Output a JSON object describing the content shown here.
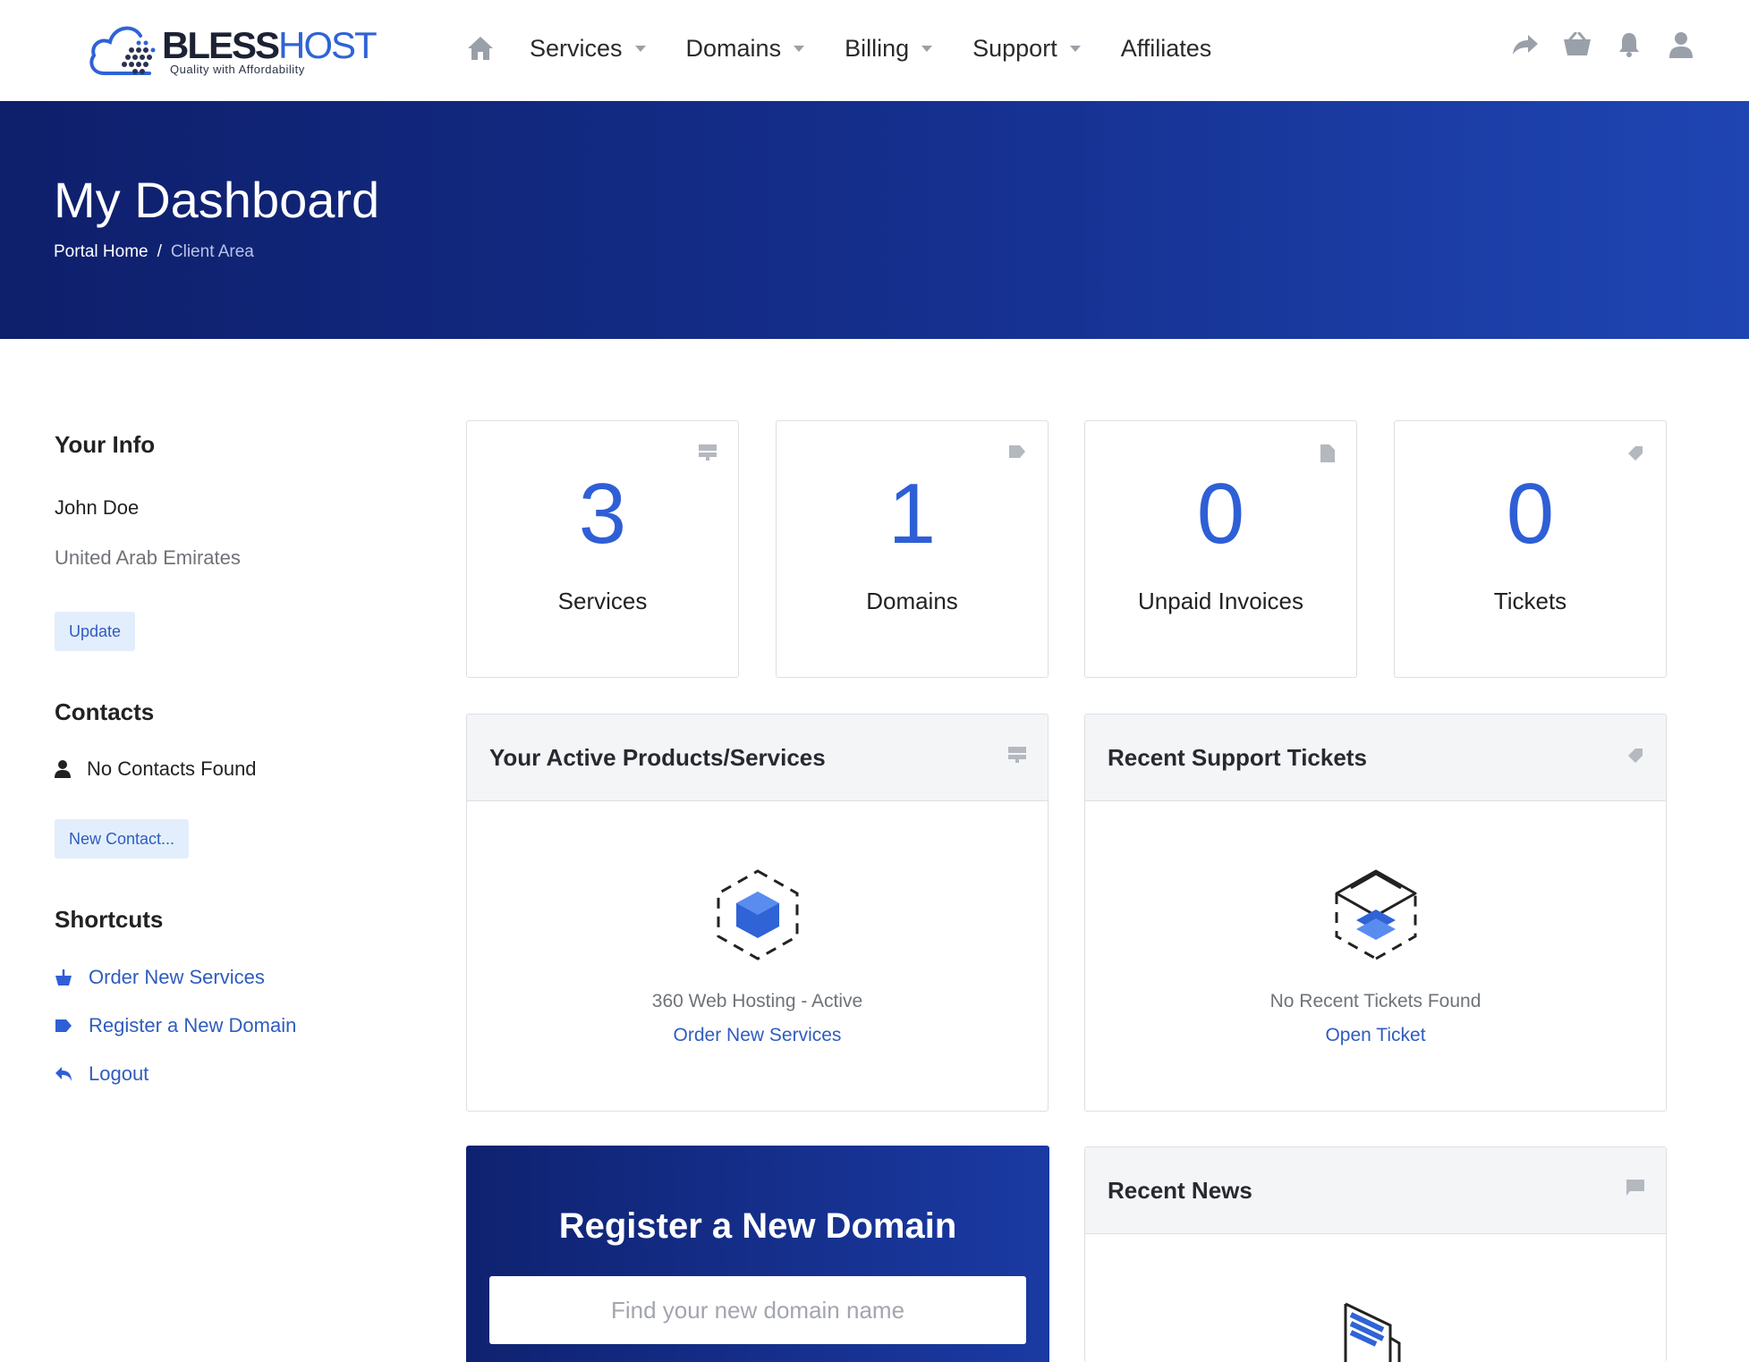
{
  "brand": {
    "name_part1": "BLESS",
    "name_part2": "HOST",
    "tagline": "Quality with Affordability"
  },
  "nav": {
    "items": [
      {
        "label": "Services",
        "dropdown": true
      },
      {
        "label": "Domains",
        "dropdown": true
      },
      {
        "label": "Billing",
        "dropdown": true
      },
      {
        "label": "Support",
        "dropdown": true
      },
      {
        "label": "Affiliates",
        "dropdown": false
      }
    ],
    "right_icons": [
      "share-icon",
      "cart-icon",
      "bell-icon",
      "user-icon"
    ]
  },
  "hero": {
    "title": "My Dashboard",
    "breadcrumb": [
      "Portal Home",
      "Client Area"
    ],
    "separator": "/"
  },
  "sidebar": {
    "info_heading": "Your Info",
    "name": "John Doe",
    "country": "United Arab Emirates",
    "update_label": "Update",
    "contacts_heading": "Contacts",
    "no_contacts": "No Contacts Found",
    "new_contact_label": "New Contact...",
    "shortcuts_heading": "Shortcuts",
    "shortcuts": [
      {
        "label": "Order New Services",
        "icon": "basket-icon"
      },
      {
        "label": "Register a New Domain",
        "icon": "tag-icon"
      },
      {
        "label": "Logout",
        "icon": "logout-arrow-icon"
      }
    ]
  },
  "stats": [
    {
      "value": "3",
      "label": "Services",
      "icon": "server-icon"
    },
    {
      "value": "1",
      "label": "Domains",
      "icon": "tag-icon"
    },
    {
      "value": "0",
      "label": "Unpaid Invoices",
      "icon": "document-icon"
    },
    {
      "value": "0",
      "label": "Tickets",
      "icon": "ticket-icon"
    }
  ],
  "panels": {
    "products": {
      "title": "Your Active Products/Services",
      "item": "360 Web Hosting - Active",
      "link": "Order New Services"
    },
    "tickets": {
      "title": "Recent Support Tickets",
      "empty": "No Recent Tickets Found",
      "link": "Open Ticket"
    },
    "news": {
      "title": "Recent News"
    }
  },
  "domain": {
    "title": "Register a New Domain",
    "placeholder": "Find your new domain name"
  },
  "colors": {
    "accent": "#2f5fd6",
    "link": "#2f5cbf",
    "hero_start": "#0e1f6b",
    "hero_end": "#1f45b3"
  }
}
